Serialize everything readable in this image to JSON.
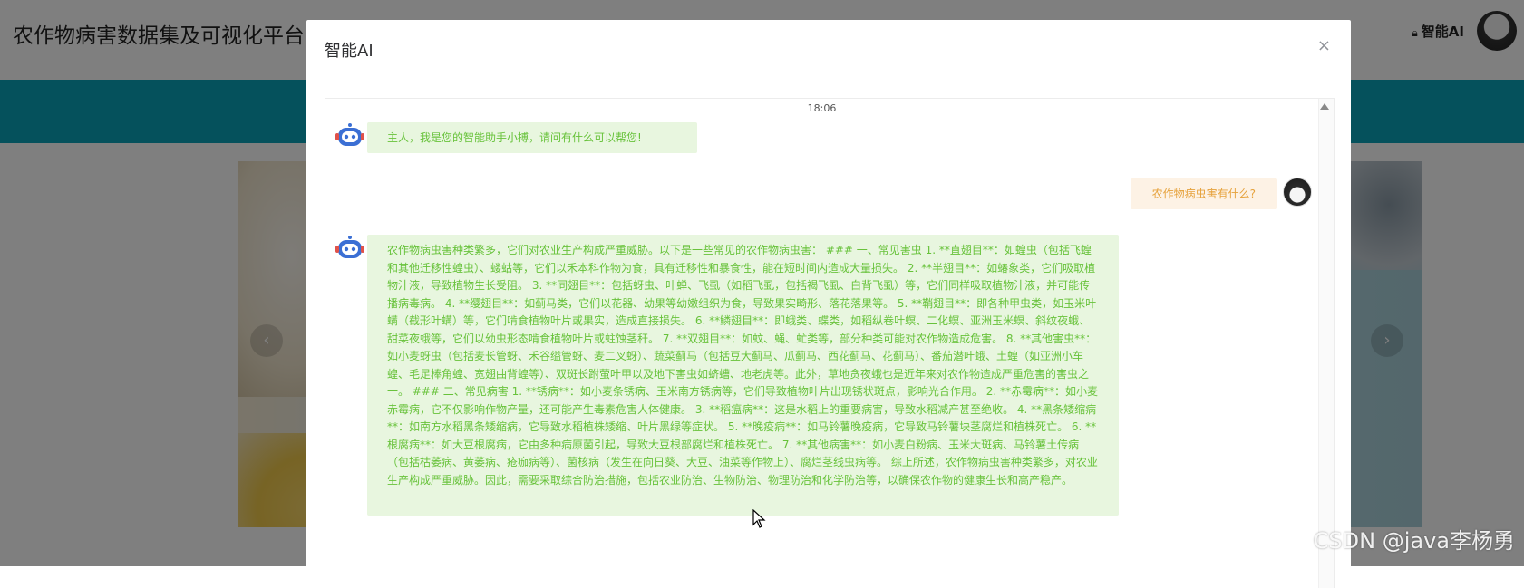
{
  "app": {
    "title": "农作物病害数据集及可视化平台",
    "user_label": "智能AI"
  },
  "dialog": {
    "title": "智能AI",
    "close_glyph": "×"
  },
  "chat": {
    "timestamp": "18:06",
    "messages": [
      {
        "role": "bot",
        "text": "主人，我是您的智能助手小搏，请问有什么可以帮您!"
      },
      {
        "role": "user",
        "text": "农作物病虫害有什么?"
      },
      {
        "role": "bot",
        "text": "农作物病虫害种类繁多，它们对农业生产构成严重威胁。以下是一些常见的农作物病虫害： ### 一、常见害虫 1. **直翅目**：如蝗虫（包括飞蝗和其他迁移性蝗虫）、蝼蛄等，它们以禾本科作物为食，具有迁移性和暴食性，能在短时间内造成大量损失。 2. **半翅目**：如蝽象类，它们吸取植物汁液，导致植物生长受阻。 3. **同翅目**：包括蚜虫、叶蝉、飞虱（如稻飞虱，包括褐飞虱、白背飞虱）等，它们同样吸取植物汁液，并可能传播病毒病。 4. **缨翅目**：如蓟马类，它们以花器、幼果等幼嫩组织为食，导致果实畸形、落花落果等。 5. **鞘翅目**：即各种甲虫类，如玉米叶螨（截形叶螨）等，它们啃食植物叶片或果实，造成直接损失。 6. **鳞翅目**：即蛾类、蝶类，如稻纵卷叶螟、二化螟、亚洲玉米螟、斜纹夜蛾、甜菜夜蛾等，它们以幼虫形态啃食植物叶片或蛀蚀茎秆。 7. **双翅目**：如蚊、蝇、虻类等，部分种类可能对农作物造成危害。 8. **其他害虫**：如小麦蚜虫（包括麦长管蚜、禾谷缢管蚜、麦二叉蚜）、蔬菜蓟马（包括豆大蓟马、瓜蓟马、西花蓟马、花蓟马）、番茄潜叶蛾、土蝗（如亚洲小车蝗、毛足棒角蝗、宽翅曲背蝗等）、双斑长跗萤叶甲以及地下害虫如蛴螬、地老虎等。此外，草地贪夜蛾也是近年来对农作物造成严重危害的害虫之一。 ### 二、常见病害 1. **锈病**：如小麦条锈病、玉米南方锈病等，它们导致植物叶片出现锈状斑点，影响光合作用。 2. **赤霉病**：如小麦赤霉病，它不仅影响作物产量，还可能产生毒素危害人体健康。 3. **稻瘟病**：这是水稻上的重要病害，导致水稻减产甚至绝收。 4. **黑条矮缩病**：如南方水稻黑条矮缩病，它导致水稻植株矮缩、叶片黑绿等症状。 5. **晚疫病**：如马铃薯晚疫病，它导致马铃薯块茎腐烂和植株死亡。 6. **根腐病**：如大豆根腐病，它由多种病原菌引起，导致大豆根部腐烂和植株死亡。 7. **其他病害**：如小麦白粉病、玉米大斑病、马铃薯土传病（包括枯萎病、黄萎病、疮痂病等）、菌核病（发生在向日葵、大豆、油菜等作物上）、腐烂茎线虫病等。 综上所述，农作物病虫害种类繁多，对农业生产构成严重威胁。因此，需要采取综合防治措施，包括农业防治、生物防治、物理防治和化学防治等，以确保农作物的健康生长和高产稳产。"
      }
    ]
  },
  "banner": {
    "prev_glyph": "‹",
    "next_glyph": "›"
  },
  "watermark": "CSDN @java李杨勇",
  "colors": {
    "teal": "#0aa3b8",
    "bot_bubble_bg": "#e8f6df",
    "bot_text": "#67c23a",
    "user_bubble_bg": "#fdf2e5",
    "user_text": "#e6a23c"
  }
}
